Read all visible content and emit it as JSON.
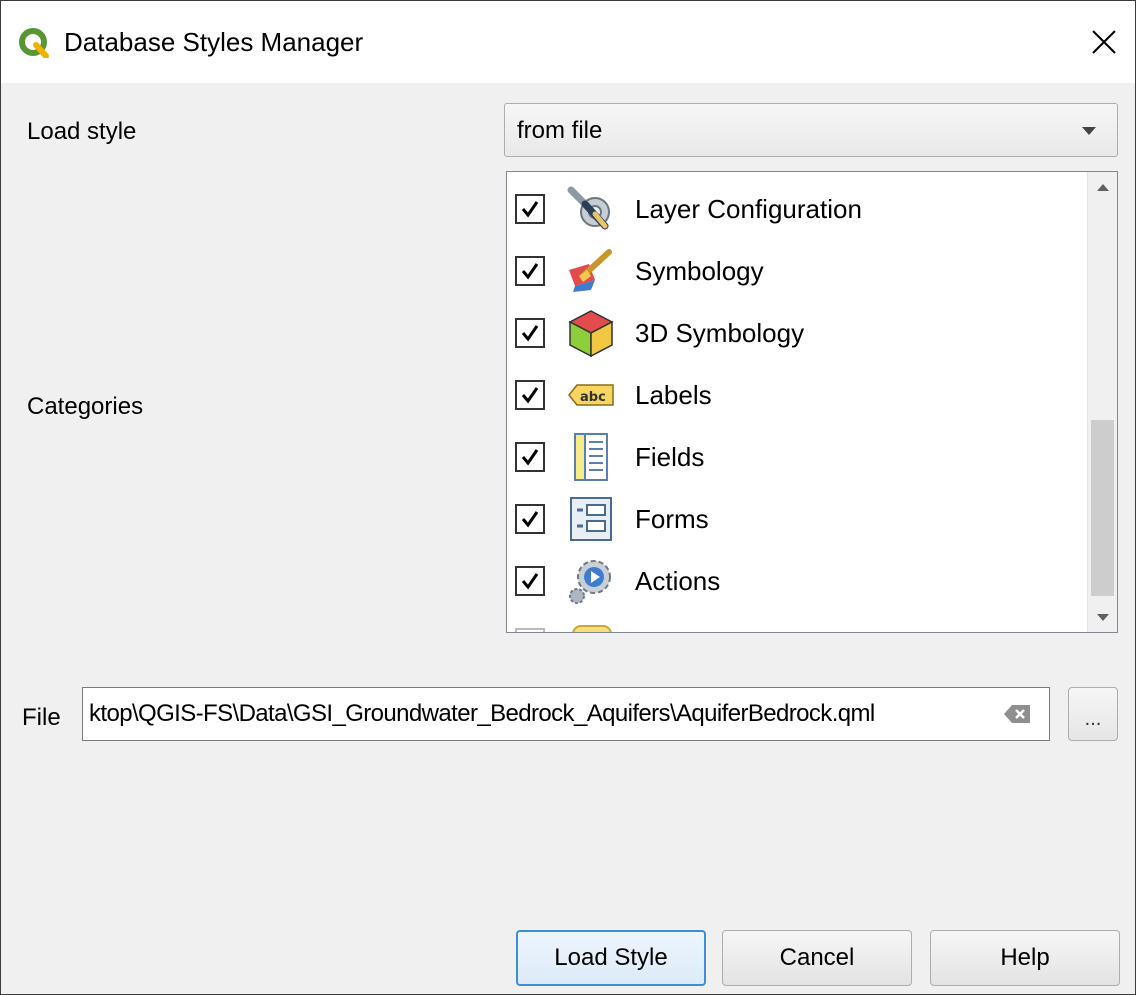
{
  "window": {
    "title": "Database Styles Manager"
  },
  "load_style": {
    "label": "Load style",
    "selected": "from file"
  },
  "categories": {
    "label": "Categories",
    "items": [
      {
        "label": "Layer Configuration",
        "checked": true,
        "icon": "wrench-gear-icon"
      },
      {
        "label": "Symbology",
        "checked": true,
        "icon": "paintbrush-icon"
      },
      {
        "label": "3D Symbology",
        "checked": true,
        "icon": "3d-cube-icon"
      },
      {
        "label": "Labels",
        "checked": true,
        "icon": "abc-label-icon"
      },
      {
        "label": "Fields",
        "checked": true,
        "icon": "fields-table-icon"
      },
      {
        "label": "Forms",
        "checked": true,
        "icon": "form-icon"
      },
      {
        "label": "Actions",
        "checked": true,
        "icon": "actions-gear-icon"
      },
      {
        "label": "",
        "checked": false,
        "icon": "partial-icon"
      }
    ]
  },
  "file": {
    "label": "File",
    "value": "ktop\\QGIS-FS\\Data\\GSI_Groundwater_Bedrock_Aquifers\\AquiferBedrock.qml",
    "browse_label": "..."
  },
  "buttons": {
    "load": "Load Style",
    "cancel": "Cancel",
    "help": "Help"
  },
  "colors": {
    "accent": "#3c8ed8",
    "qgis_green": "#589632",
    "qgis_yellow": "#ee7913"
  }
}
